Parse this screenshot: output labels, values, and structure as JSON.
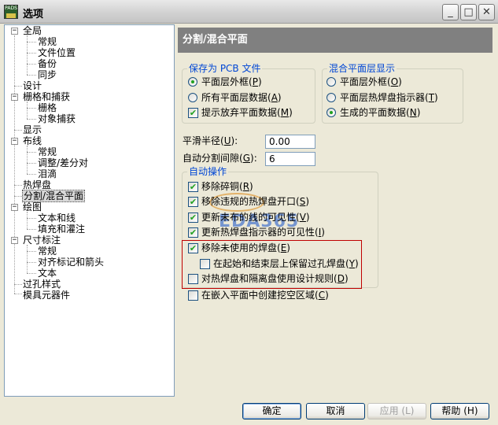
{
  "window": {
    "title": "选项",
    "app_icon_text": "PADS",
    "minimize": "_",
    "maximize": "□",
    "close": "✕"
  },
  "tree": {
    "items": [
      {
        "label": "全局",
        "toggle": "−"
      },
      {
        "label": "常规"
      },
      {
        "label": "文件位置"
      },
      {
        "label": "备份"
      },
      {
        "label": "同步"
      },
      {
        "label": "设计"
      },
      {
        "label": "栅格和捕获",
        "toggle": "−"
      },
      {
        "label": "栅格"
      },
      {
        "label": "对象捕获"
      },
      {
        "label": "显示"
      },
      {
        "label": "布线",
        "toggle": "−"
      },
      {
        "label": "常规"
      },
      {
        "label": "调整/差分对"
      },
      {
        "label": "泪滴"
      },
      {
        "label": "热焊盘"
      },
      {
        "label": "分割/混合平面",
        "selected": true
      },
      {
        "label": "绘图",
        "toggle": "−"
      },
      {
        "label": "文本和线"
      },
      {
        "label": "填充和灌注"
      },
      {
        "label": "尺寸标注",
        "toggle": "−"
      },
      {
        "label": "常规"
      },
      {
        "label": "对齐标记和箭头"
      },
      {
        "label": "文本"
      },
      {
        "label": "过孔样式"
      },
      {
        "label": "模具元器件"
      }
    ]
  },
  "page": {
    "title": "分割/混合平面",
    "save_as_pcb": {
      "title": "保存为 PCB 文件",
      "options": [
        {
          "label": "平面层外框",
          "hotkey": "P",
          "selected": true
        },
        {
          "label": "所有平面层数据",
          "hotkey": "A",
          "selected": false
        }
      ],
      "checkbox": {
        "label": "提示放弃平面数据",
        "hotkey": "M",
        "checked": true
      }
    },
    "mixed_display": {
      "title": "混合平面层显示",
      "options": [
        {
          "label": "平面层外框",
          "hotkey": "O",
          "selected": false
        },
        {
          "label": "平面层热焊盘指示器",
          "hotkey": "T",
          "selected": false
        },
        {
          "label": "生成的平面数据",
          "hotkey": "N",
          "selected": true
        }
      ]
    },
    "smooth_radius": {
      "label": "平滑半径",
      "hotkey": "U",
      "value": "0.00"
    },
    "auto_split_gap": {
      "label": "自动分割间隙",
      "hotkey": "G",
      "value": "6"
    },
    "auto_ops": {
      "title": "自动操作",
      "items": [
        {
          "label": "移除碎铜",
          "hotkey": "R",
          "checked": true
        },
        {
          "label": "移除违规的热焊盘开口",
          "hotkey": "S",
          "checked": true
        },
        {
          "label": "更新未布的线的可见性",
          "hotkey": "V",
          "checked": true
        },
        {
          "label": "更新热焊盘指示器的可见性",
          "hotkey": "I",
          "checked": true
        },
        {
          "label": "移除未使用的焊盘",
          "hotkey": "E",
          "checked": true
        },
        {
          "label": "在起始和结束层上保留过孔焊盘",
          "hotkey": "Y",
          "checked": false
        },
        {
          "label": "对热焊盘和隔离盘使用设计规则",
          "hotkey": "D",
          "checked": false
        }
      ]
    },
    "cavity": {
      "label": "在嵌入平面中创建挖空区域",
      "hotkey": "C",
      "checked": false
    }
  },
  "watermark": {
    "text": "EDA365"
  },
  "buttons": {
    "ok": "确定",
    "cancel": "取消",
    "apply": "应用 (L)",
    "help": "帮助 (H)"
  },
  "colors": {
    "group_title": "#0046d5",
    "check_mark": "#21a121",
    "highlight_box": "#c00000",
    "header_bg": "#808080"
  }
}
